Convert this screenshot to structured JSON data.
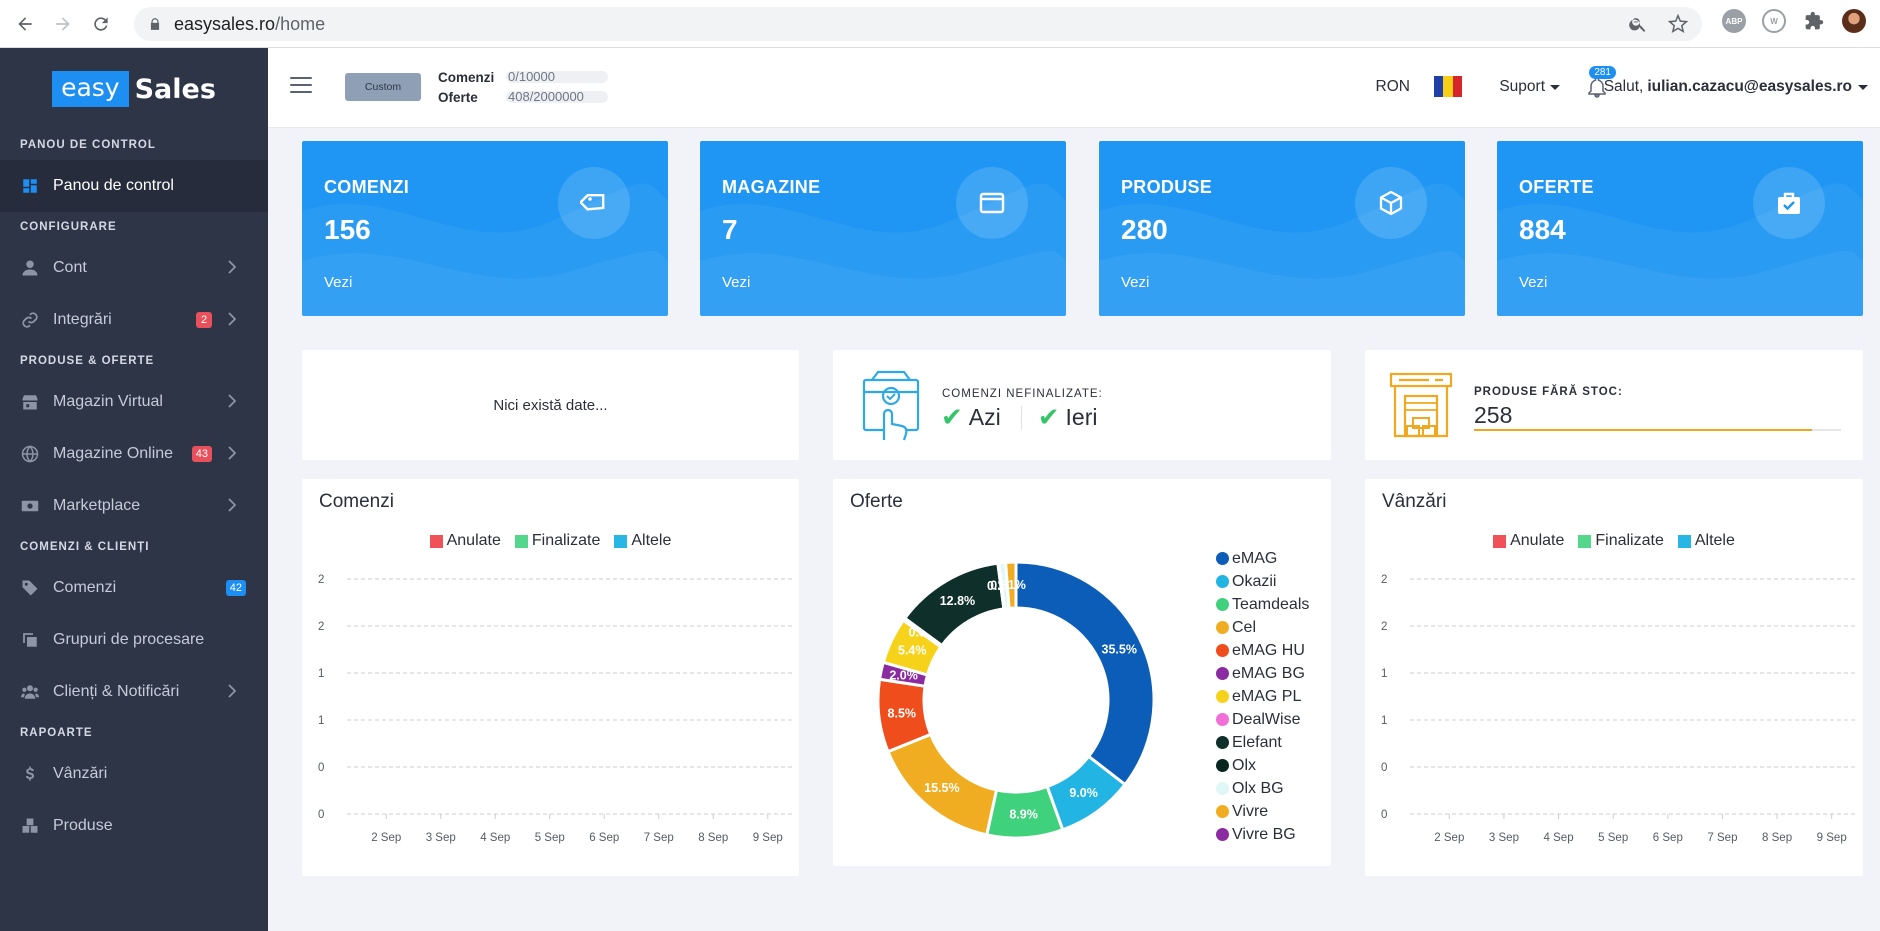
{
  "browser": {
    "url_domain": "easysales.ro",
    "url_path": "/home",
    "extensions": [
      "ABP"
    ]
  },
  "sidebar": {
    "brand_easy": "easy",
    "brand_sales": "Sales",
    "sections": [
      {
        "title": "PANOU DE CONTROL",
        "items": [
          {
            "label": "Panou de control",
            "icon": "dashboard-icon",
            "active": true
          }
        ]
      },
      {
        "title": "CONFIGURARE",
        "items": [
          {
            "label": "Cont",
            "icon": "user-icon",
            "chevron": true
          },
          {
            "label": "Integrări",
            "icon": "link-icon",
            "chevron": true,
            "badge": "2",
            "badge_color": "red"
          }
        ]
      },
      {
        "title": "PRODUSE & OFERTE",
        "items": [
          {
            "label": "Magazin Virtual",
            "icon": "store-icon",
            "chevron": true
          },
          {
            "label": "Magazine Online",
            "icon": "globe-icon",
            "chevron": true,
            "badge": "43",
            "badge_color": "red"
          },
          {
            "label": "Marketplace",
            "icon": "money-icon",
            "chevron": true
          }
        ]
      },
      {
        "title": "COMENZI & CLIENȚI",
        "items": [
          {
            "label": "Comenzi",
            "icon": "tag-icon",
            "badge": "42",
            "badge_color": "blue"
          },
          {
            "label": "Grupuri de procesare",
            "icon": "copy-icon"
          },
          {
            "label": "Clienți & Notificări",
            "icon": "users-icon",
            "chevron": true
          }
        ]
      },
      {
        "title": "RAPOARTE",
        "items": [
          {
            "label": "Vânzări",
            "icon": "dollar-icon"
          },
          {
            "label": "Produse",
            "icon": "boxes-icon"
          }
        ]
      }
    ]
  },
  "header": {
    "plan": "Custom",
    "quota": [
      {
        "label": "Comenzi",
        "value": "0/10000",
        "fraction": 0.0
      },
      {
        "label": "Oferte",
        "value": "408/2000000",
        "fraction": 0.0002
      }
    ],
    "currency": "RON",
    "support": "Suport",
    "notifications": "281",
    "greeting": "Salut,",
    "user": "iulian.cazacu@easysales.ro"
  },
  "stats": [
    {
      "title": "COMENZI",
      "value": "156",
      "link": "Vezi",
      "icon": "tag-icon"
    },
    {
      "title": "MAGAZINE",
      "value": "7",
      "link": "Vezi",
      "icon": "window-icon"
    },
    {
      "title": "PRODUSE",
      "value": "280",
      "link": "Vezi",
      "icon": "box-icon"
    },
    {
      "title": "OFERTE",
      "value": "884",
      "link": "Vezi",
      "icon": "briefcase-icon"
    }
  ],
  "info": {
    "no_data": "Nici există date...",
    "pending_label": "COMENZI NEFINALIZATE:",
    "today": "Azi",
    "yesterday": "Ieri",
    "no_stock_label": "PRODUSE FĂRĂ STOC:",
    "no_stock_value": "258",
    "no_stock_fraction": 0.92
  },
  "charts": {
    "orders_title": "Comenzi",
    "offers_title": "Oferte",
    "sales_title": "Vânzări",
    "legend": [
      {
        "name": "Anulate",
        "color": "#f0525a"
      },
      {
        "name": "Finalizate",
        "color": "#54d68c"
      },
      {
        "name": "Altele",
        "color": "#28b7e4"
      }
    ]
  },
  "chart_data": [
    {
      "type": "line",
      "title": "Comenzi",
      "categories": [
        "2 Sep",
        "3 Sep",
        "4 Sep",
        "5 Sep",
        "6 Sep",
        "7 Sep",
        "8 Sep",
        "9 Sep"
      ],
      "y_tick_labels": [
        "2",
        "2",
        "1",
        "1",
        "0",
        "0"
      ],
      "series": [
        {
          "name": "Anulate",
          "values": [
            0,
            0,
            0,
            0,
            0,
            0,
            0,
            0
          ]
        },
        {
          "name": "Finalizate",
          "values": [
            0,
            0,
            0,
            0,
            0,
            0,
            0,
            0
          ]
        },
        {
          "name": "Altele",
          "values": [
            0,
            0,
            0,
            0,
            0,
            0,
            0,
            0
          ]
        }
      ],
      "grid": true,
      "legend_position": "top"
    },
    {
      "type": "pie",
      "title": "Oferte",
      "donut": true,
      "slices": [
        {
          "name": "eMAG",
          "value": 35.5,
          "label": "35.5%",
          "color": "#0b5db8"
        },
        {
          "name": "Okazii",
          "value": 9.0,
          "label": "9.0%",
          "color": "#22b4e3"
        },
        {
          "name": "Teamdeals",
          "value": 8.9,
          "label": "8.9%",
          "color": "#3fd17c"
        },
        {
          "name": "Cel",
          "value": 15.5,
          "label": "15.5%",
          "color": "#f0ad22"
        },
        {
          "name": "eMAG HU",
          "value": 8.5,
          "label": "8.5%",
          "color": "#ef4d1c"
        },
        {
          "name": "eMAG BG",
          "value": 2.0,
          "label": "2.0%",
          "color": "#8c2ba1"
        },
        {
          "name": "eMAG PL",
          "value": 5.4,
          "label": "5.4%",
          "color": "#f7d21a"
        },
        {
          "name": "DealWise",
          "value": 0.3,
          "label": "0.3%",
          "color": "#f26fd8"
        },
        {
          "name": "Elefant",
          "value": 12.8,
          "label": "12.8%",
          "color": "#0e2f2a"
        },
        {
          "name": "Olx",
          "value": 0.1,
          "label": "0.1%",
          "color": "#06251f"
        },
        {
          "name": "Olx BG",
          "value": 0.8,
          "label": "0.8%",
          "color": "#dff7f6"
        },
        {
          "name": "Vivre",
          "value": 1.2,
          "label": "1.1%",
          "color": "#f0ad22"
        },
        {
          "name": "Vivre BG",
          "value": 0.0,
          "label": "",
          "color": "#8c2ba1"
        }
      ],
      "legend_position": "right"
    },
    {
      "type": "line",
      "title": "Vânzări",
      "categories": [
        "2 Sep",
        "3 Sep",
        "4 Sep",
        "5 Sep",
        "6 Sep",
        "7 Sep",
        "8 Sep",
        "9 Sep"
      ],
      "y_tick_labels": [
        "2",
        "2",
        "1",
        "1",
        "0",
        "0"
      ],
      "series": [
        {
          "name": "Anulate",
          "values": [
            0,
            0,
            0,
            0,
            0,
            0,
            0,
            0
          ]
        },
        {
          "name": "Finalizate",
          "values": [
            0,
            0,
            0,
            0,
            0,
            0,
            0,
            0
          ]
        },
        {
          "name": "Altele",
          "values": [
            0,
            0,
            0,
            0,
            0,
            0,
            0,
            0
          ]
        }
      ],
      "grid": true,
      "legend_position": "top"
    }
  ]
}
